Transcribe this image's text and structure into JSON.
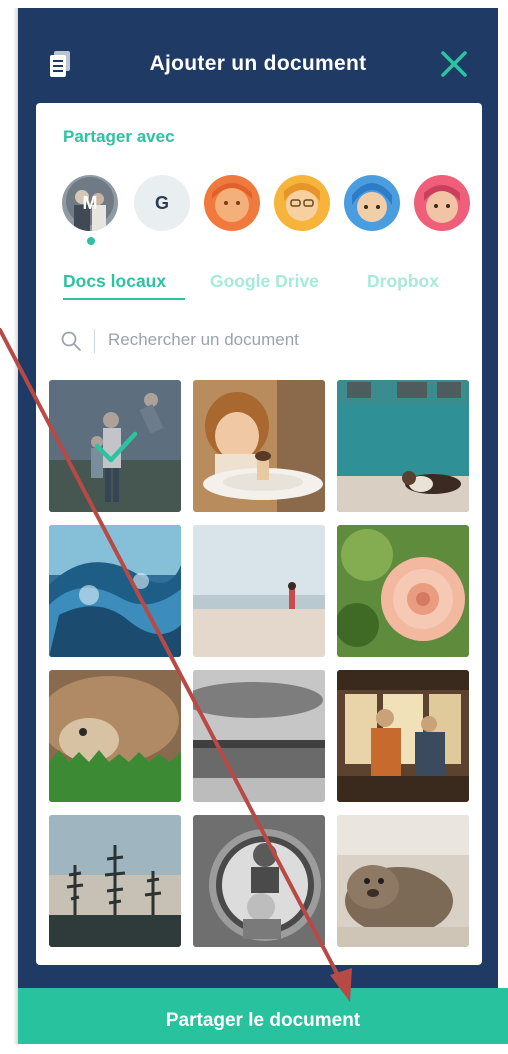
{
  "header": {
    "title": "Ajouter un document",
    "left_icon": "document-list-icon",
    "right_icon": "close-icon"
  },
  "share": {
    "label": "Partager avec",
    "recipients": [
      {
        "kind": "photo",
        "initial": "M",
        "selected": true
      },
      {
        "kind": "initial",
        "initial": "G",
        "selected": false
      },
      {
        "kind": "photo",
        "initial": "",
        "selected": false
      },
      {
        "kind": "photo",
        "initial": "",
        "selected": false
      },
      {
        "kind": "photo",
        "initial": "",
        "selected": false
      },
      {
        "kind": "photo",
        "initial": "",
        "selected": false
      }
    ]
  },
  "tabs": [
    {
      "label": "Docs locaux",
      "active": true
    },
    {
      "label": "Google Drive",
      "active": false
    },
    {
      "label": "Dropbox",
      "active": false
    }
  ],
  "search": {
    "placeholder": "Rechercher un document",
    "value": ""
  },
  "documents": {
    "count": 12,
    "selected_index": 0
  },
  "footer": {
    "button_label": "Partager le document"
  },
  "colors": {
    "panel_bg": "#1f3a64",
    "accent": "#2cc3a0",
    "tab_inactive": "#a6ead9",
    "annotation_arrow": "#b84a45"
  }
}
